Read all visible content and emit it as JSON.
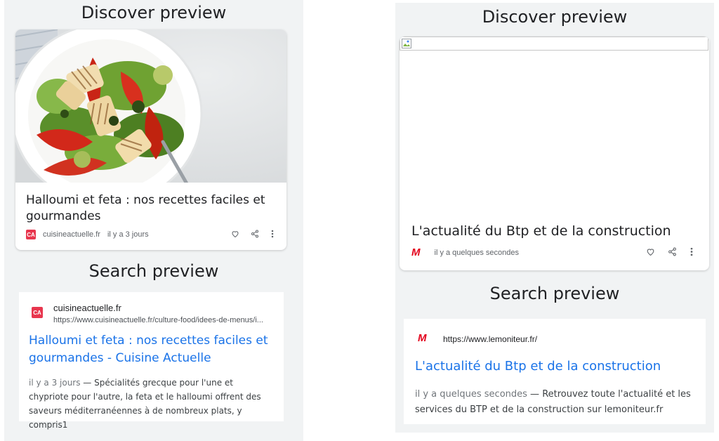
{
  "left": {
    "discover_heading": "Discover preview",
    "discover_card": {
      "title": "Halloumi et feta : nos recettes faciles et gourmandes",
      "source": "cuisineactuelle.fr",
      "age": "il y a 3 jours",
      "logo_text": "CA"
    },
    "search_heading": "Search preview",
    "search_card": {
      "site_name": "cuisineactuelle.fr",
      "url": "https://www.cuisineactuelle.fr/culture-food/idees-de-menus/i...",
      "title": "Halloumi et feta : nos recettes faciles et gourmandes - Cuisine Actuelle",
      "snippet_age": "il y a 3 jours",
      "snippet_sep": " — ",
      "snippet": "Spécialités grecque pour l'une et chypriote pour l'autre, la feta et le halloumi offrent des saveurs méditerranéennes à de nombreux plats, y compris1",
      "logo_text": "CA"
    }
  },
  "right": {
    "discover_heading": "Discover preview",
    "discover_card": {
      "title": "L'actualité du Btp et de la construction",
      "age": "il y a quelques secondes",
      "logo_text": "M"
    },
    "search_heading": "Search preview",
    "search_card": {
      "url": "https://www.lemoniteur.fr/",
      "title": "L'actualité du Btp et de la construction",
      "snippet_age": "il y a quelques secondes",
      "snippet_sep": " — ",
      "snippet": "Retrouvez toute l'actualité et les services du BTP et de la construction sur lemoniteur.fr",
      "logo_text": "M"
    }
  },
  "icons": [
    "heart-icon",
    "share-icon",
    "more-vert-icon"
  ],
  "colors": {
    "link_blue": "#1a73e8",
    "panel_bg": "#f1f3f4",
    "ca_red": "#e8364e",
    "moniteur_red": "#e3001b"
  }
}
